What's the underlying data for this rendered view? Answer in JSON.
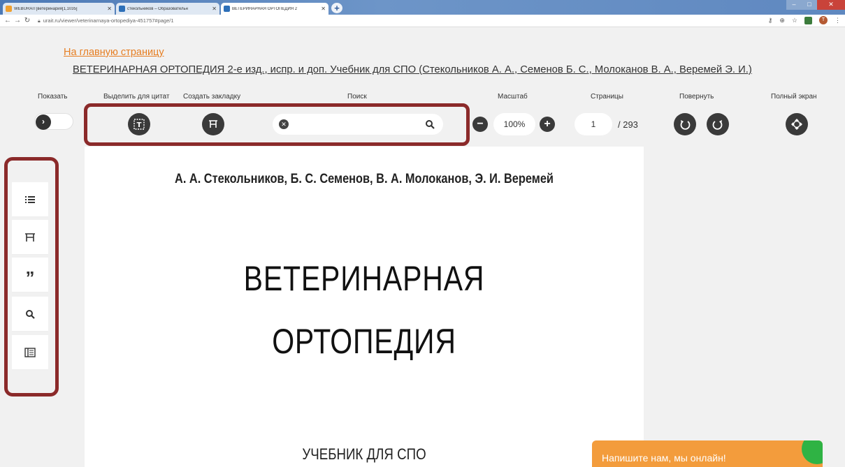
{
  "browser": {
    "tabs": [
      {
        "title": "WEBURAIT[ветеринария[1,1035]",
        "active": false,
        "favicon_color": "#f0a030"
      },
      {
        "title": "стекольников – Образовательн",
        "active": false,
        "favicon_color": "#2d6fb8"
      },
      {
        "title": "ВЕТЕРИНАРНАЯ ОРТОПЕДИЯ 2",
        "active": true,
        "favicon_color": "#2d6fb8"
      }
    ],
    "new_tab_label": "+",
    "url": "urait.ru/viewer/veterinarnaya-ortopediya-451757#page/1",
    "profile_initial": "T"
  },
  "header": {
    "home_link": "На главную страницу",
    "book_title": "ВЕТЕРИНАРНАЯ ОРТОПЕДИЯ 2-е изд., испр. и доп. Учебник для СПО (Стекольников А. А., Семенов Б. С., Молоканов В. А., Веремей Э. И.)"
  },
  "toolbar": {
    "show_label": "Показать",
    "highlight_label": "Выделить для цитат",
    "bookmark_label": "Создать закладку",
    "search_label": "Поиск",
    "search_value": "",
    "zoom_label": "Масштаб",
    "zoom_value": "100%",
    "pages_label": "Страницы",
    "page_current": "1",
    "page_total": "/ 293",
    "rotate_label": "Повернуть",
    "fullscreen_label": "Полный экран"
  },
  "sidebar": {
    "items": [
      {
        "name": "contents",
        "icon": "list-icon"
      },
      {
        "name": "bookmarks",
        "icon": "bookmark-icon"
      },
      {
        "name": "quotes",
        "icon": "quote-icon"
      },
      {
        "name": "search",
        "icon": "search-icon"
      },
      {
        "name": "notes",
        "icon": "book-panel-icon"
      }
    ]
  },
  "document": {
    "authors": "А. А. Стекольников, Б. С. Семенов, В. А. Молоканов, Э. И. Веремей",
    "title_line1": "ВЕТЕРИНАРНАЯ",
    "title_line2": "ОРТОПЕДИЯ",
    "subtitle": "УЧЕБНИК ДЛЯ СПО"
  },
  "chat": {
    "label": "Напишите нам, мы онлайн!"
  },
  "colors": {
    "accent_link": "#e67e22",
    "highlight_frame": "#8b2a2a",
    "chat_bg": "#f39c3c",
    "button_dark": "#3a3a3a"
  }
}
